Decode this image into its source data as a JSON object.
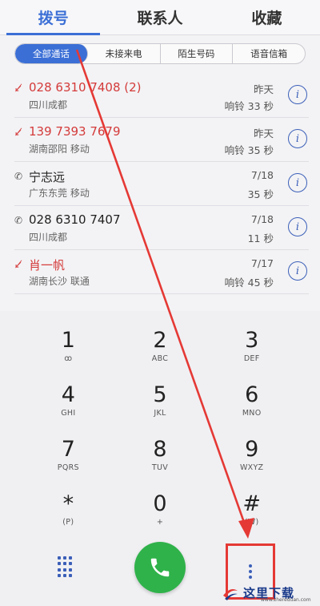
{
  "tabs": [
    {
      "label": "拨号",
      "active": true
    },
    {
      "label": "联系人",
      "active": false
    },
    {
      "label": "收藏",
      "active": false
    }
  ],
  "filters": [
    {
      "label": "全部通话",
      "active": true
    },
    {
      "label": "未接来电",
      "active": false
    },
    {
      "label": "陌生号码",
      "active": false
    },
    {
      "label": "语音信箱",
      "active": false
    }
  ],
  "calls": [
    {
      "name": "028 6310 7408 (2)",
      "sub": "四川成都",
      "date": "昨天",
      "duration": "响铃 33 秒",
      "missed": true,
      "icon": "missed-call-icon"
    },
    {
      "name": "139 7393 7679",
      "sub": "湖南邵阳 移动",
      "date": "昨天",
      "duration": "响铃 35 秒",
      "missed": true,
      "icon": "missed-call-icon"
    },
    {
      "name": "宁志远",
      "sub": "广东东莞 移动",
      "date": "7/18",
      "duration": "35 秒",
      "missed": false,
      "icon": "outgoing-call-icon"
    },
    {
      "name": "028 6310 7407",
      "sub": "四川成都",
      "date": "7/18",
      "duration": "11 秒",
      "missed": false,
      "icon": "outgoing-call-icon"
    },
    {
      "name": "肖一帆",
      "sub": "湖南长沙 联通",
      "date": "7/17",
      "duration": "响铃 45 秒",
      "missed": true,
      "icon": "missed-call-icon"
    }
  ],
  "info_label": "i",
  "keys": [
    {
      "digit": "1",
      "letters": "ꝏ"
    },
    {
      "digit": "2",
      "letters": "ABC"
    },
    {
      "digit": "3",
      "letters": "DEF"
    },
    {
      "digit": "4",
      "letters": "GHI"
    },
    {
      "digit": "5",
      "letters": "JKL"
    },
    {
      "digit": "6",
      "letters": "MNO"
    },
    {
      "digit": "7",
      "letters": "PQRS"
    },
    {
      "digit": "8",
      "letters": "TUV"
    },
    {
      "digit": "9",
      "letters": "WXYZ"
    },
    {
      "digit": "*",
      "letters": "(P)"
    },
    {
      "digit": "0",
      "letters": "+"
    },
    {
      "digit": "#",
      "letters": "(W)"
    }
  ],
  "watermark": {
    "text": "这里下载",
    "url": "www.zhereduan.com"
  },
  "colors": {
    "accent": "#3b6fd6",
    "missed": "#d43a3a",
    "call_green": "#2fb24a",
    "annotation_red": "#e53935"
  }
}
